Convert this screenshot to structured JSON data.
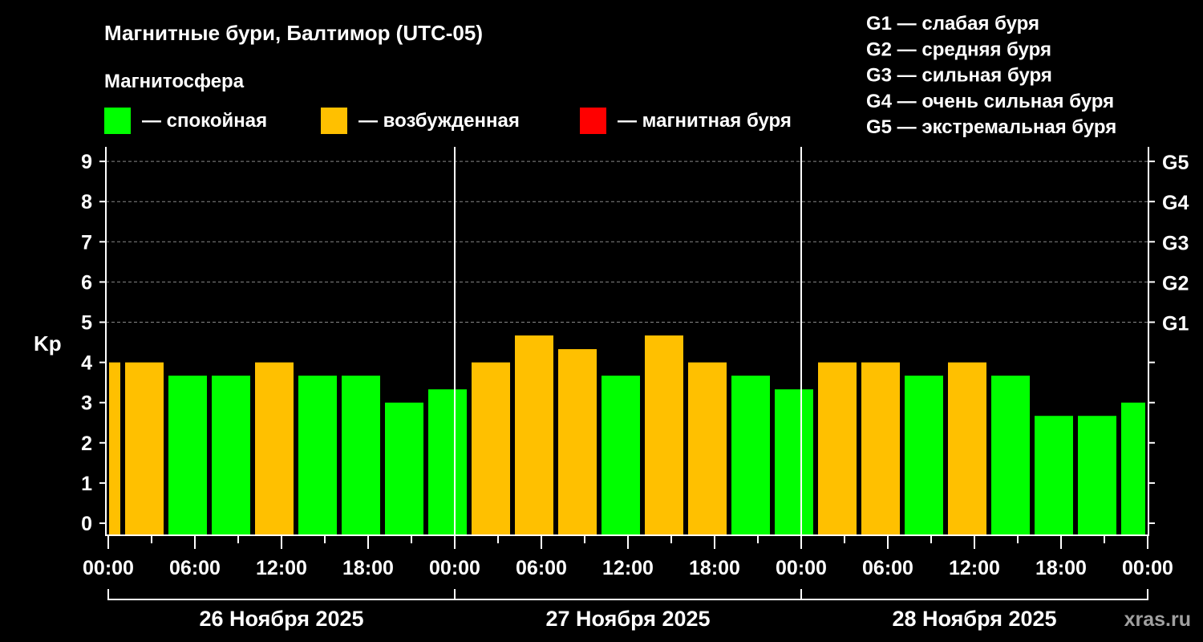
{
  "chart_data": {
    "type": "bar",
    "title": "Магнитные бури, Балтимор (UTC-05)",
    "legend_title": "Магнитосфера",
    "legend": [
      {
        "label": "— спокойная",
        "color": "#00ff00"
      },
      {
        "label": "— возбужденная",
        "color": "#ffc000"
      },
      {
        "label": "— магнитная буря",
        "color": "#ff0000"
      }
    ],
    "g_scale": [
      "G1 — слабая буря",
      "G2 — средняя буря",
      "G3 — сильная буря",
      "G4 — очень сильная буря",
      "G5 — экстремальная буря"
    ],
    "ylabel": "Kp",
    "ylim": [
      0,
      9
    ],
    "yticks": [
      "0",
      "1",
      "2",
      "3",
      "4",
      "5",
      "6",
      "7",
      "8",
      "9"
    ],
    "right_ticks": [
      {
        "kp": 5,
        "label": "G1"
      },
      {
        "kp": 6,
        "label": "G2"
      },
      {
        "kp": 7,
        "label": "G3"
      },
      {
        "kp": 8,
        "label": "G4"
      },
      {
        "kp": 9,
        "label": "G5"
      }
    ],
    "xlim_hours": [
      0,
      72
    ],
    "xticks": [
      "00:00",
      "06:00",
      "12:00",
      "18:00",
      "00:00",
      "06:00",
      "12:00",
      "18:00",
      "00:00",
      "06:00",
      "12:00",
      "18:00",
      "00:00"
    ],
    "days": [
      "26 Ноября 2025",
      "27 Ноября 2025",
      "28 Ноября 2025"
    ],
    "bars": [
      {
        "start": -2,
        "end": 1,
        "kp": 4.0,
        "level": "excited"
      },
      {
        "start": 1,
        "end": 4,
        "kp": 4.0,
        "level": "excited"
      },
      {
        "start": 4,
        "end": 7,
        "kp": 3.67,
        "level": "quiet"
      },
      {
        "start": 7,
        "end": 10,
        "kp": 3.67,
        "level": "quiet"
      },
      {
        "start": 10,
        "end": 13,
        "kp": 4.0,
        "level": "excited"
      },
      {
        "start": 13,
        "end": 16,
        "kp": 3.67,
        "level": "quiet"
      },
      {
        "start": 16,
        "end": 19,
        "kp": 3.67,
        "level": "quiet"
      },
      {
        "start": 19,
        "end": 22,
        "kp": 3.0,
        "level": "quiet"
      },
      {
        "start": 22,
        "end": 25,
        "kp": 3.33,
        "level": "quiet"
      },
      {
        "start": 25,
        "end": 28,
        "kp": 4.0,
        "level": "excited"
      },
      {
        "start": 28,
        "end": 31,
        "kp": 4.67,
        "level": "excited"
      },
      {
        "start": 31,
        "end": 34,
        "kp": 4.33,
        "level": "excited"
      },
      {
        "start": 34,
        "end": 37,
        "kp": 3.67,
        "level": "quiet"
      },
      {
        "start": 37,
        "end": 40,
        "kp": 4.67,
        "level": "excited"
      },
      {
        "start": 40,
        "end": 43,
        "kp": 4.0,
        "level": "excited"
      },
      {
        "start": 43,
        "end": 46,
        "kp": 3.67,
        "level": "quiet"
      },
      {
        "start": 46,
        "end": 49,
        "kp": 3.33,
        "level": "quiet"
      },
      {
        "start": 49,
        "end": 52,
        "kp": 4.0,
        "level": "excited"
      },
      {
        "start": 52,
        "end": 55,
        "kp": 4.0,
        "level": "excited"
      },
      {
        "start": 55,
        "end": 58,
        "kp": 3.67,
        "level": "quiet"
      },
      {
        "start": 58,
        "end": 61,
        "kp": 4.0,
        "level": "excited"
      },
      {
        "start": 61,
        "end": 64,
        "kp": 3.67,
        "level": "quiet"
      },
      {
        "start": 64,
        "end": 67,
        "kp": 2.67,
        "level": "quiet"
      },
      {
        "start": 67,
        "end": 70,
        "kp": 2.67,
        "level": "quiet"
      },
      {
        "start": 70,
        "end": 73,
        "kp": 3.0,
        "level": "quiet"
      }
    ],
    "colors": {
      "quiet": "#00ff00",
      "excited": "#ffc000",
      "storm": "#ff0000"
    },
    "watermark": "xras.ru"
  }
}
